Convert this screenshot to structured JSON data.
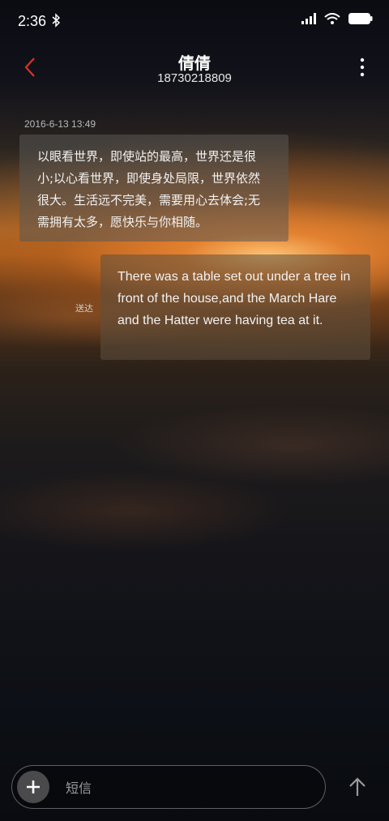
{
  "status_bar": {
    "time": "2:36"
  },
  "header": {
    "contact_name": "倩倩",
    "phone_number": "18730218809"
  },
  "conversation": {
    "timestamp": "2016-6-13 13:49",
    "received_message": "以眼看世界，即使站的最高，世界还是很小;以心看世界，即使身处局限，世界依然很大。生活远不完美，需要用心去体会;无需拥有太多，愿快乐与你相随。",
    "sent_message": "There was a table set out under a tree in front of the house,and the March Hare and the Hatter were having tea at it.",
    "sent_status": "送达"
  },
  "composer": {
    "placeholder": "短信"
  },
  "colors": {
    "accent_red": "#d9322c",
    "bubble_bg": "#5a5854"
  }
}
